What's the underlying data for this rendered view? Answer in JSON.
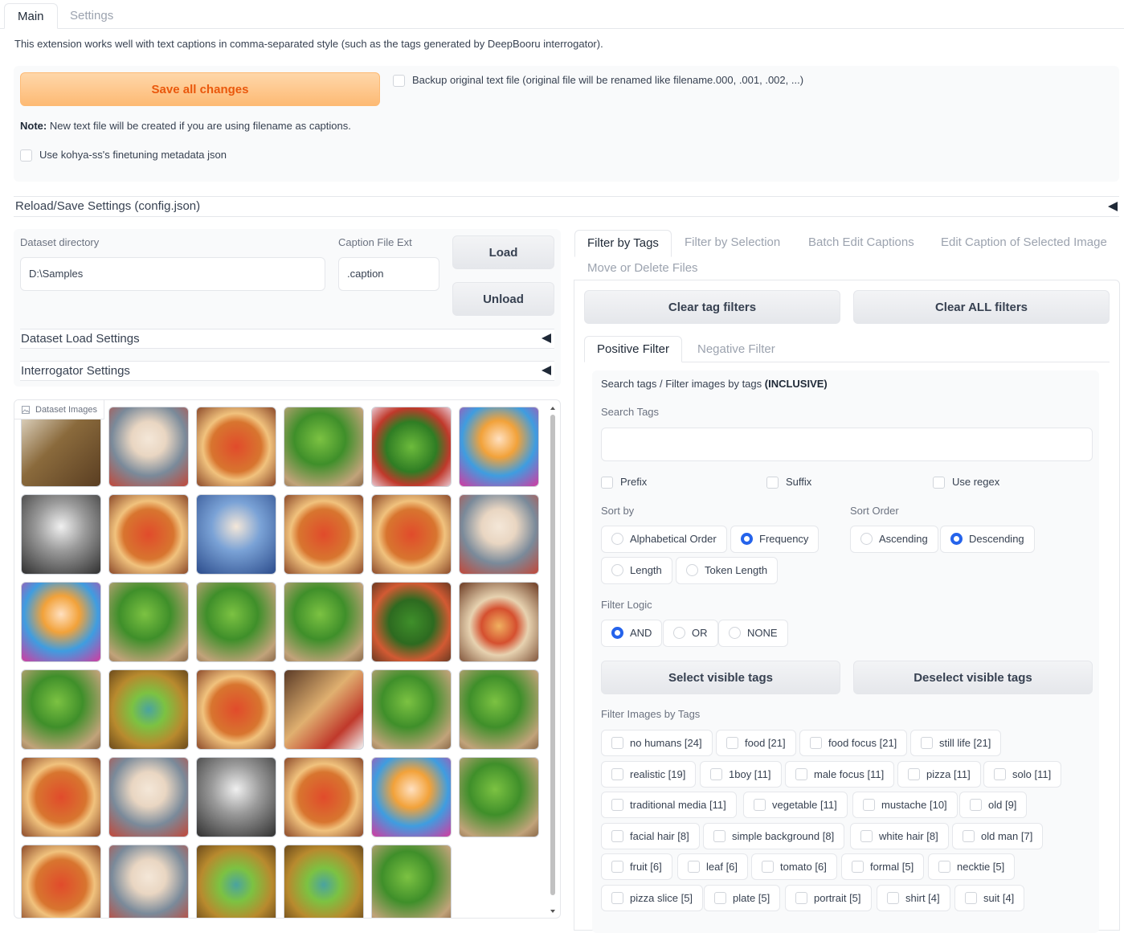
{
  "tabs": [
    {
      "label": "Main",
      "active": true
    },
    {
      "label": "Settings",
      "active": false
    }
  ],
  "description": "This extension works well with text captions in comma-separated style (such as the tags generated by DeepBooru interrogator).",
  "save": {
    "button_label": "Save all changes",
    "backup_label": "Backup original text file (original file will be renamed like filename.000, .001, .002, ...)",
    "note_bold": "Note:",
    "note_text": " New text file will be created if you are using filename as captions.",
    "kohya_label": "Use kohya-ss's finetuning metadata json"
  },
  "reload_settings_label": "Reload/Save Settings (config.json)",
  "dataset": {
    "dir_label": "Dataset directory",
    "dir_value": "D:\\Samples",
    "ext_label": "Caption File Ext",
    "ext_value": ".caption",
    "load_label": "Load",
    "unload_label": "Unload",
    "load_settings_label": "Dataset Load Settings",
    "interrogator_label": "Interrogator Settings"
  },
  "gallery": {
    "label": "Dataset Images",
    "images": [
      "man-writing",
      "einstein",
      "pizza",
      "broccoli",
      "broccoli-salad",
      "einstein-colorful",
      "einstein-bw",
      "pizza",
      "einstein-blue",
      "pizza",
      "pizza",
      "einstein",
      "einstein-colorful",
      "broccoli",
      "broccoli",
      "broccoli",
      "broccoli-pizza",
      "pizza-painting",
      "broccoli",
      "broccoli-frame",
      "pizza",
      "pizza-slices",
      "broccoli",
      "broccoli",
      "pizza",
      "einstein",
      "einstein-bw",
      "pizza",
      "einstein-colorful",
      "broccoli",
      "pizza",
      "einstein",
      "broccoli-frame",
      "broccoli-frame",
      "broccoli"
    ]
  },
  "right_tabs": [
    {
      "label": "Filter by Tags",
      "active": true
    },
    {
      "label": "Filter by Selection",
      "active": false
    },
    {
      "label": "Batch Edit Captions",
      "active": false
    },
    {
      "label": "Edit Caption of Selected Image",
      "active": false
    },
    {
      "label": "Move or Delete Files",
      "active": false
    }
  ],
  "filter": {
    "clear_tag_filters": "Clear tag filters",
    "clear_all_filters": "Clear ALL filters",
    "positive_tab": "Positive Filter",
    "negative_tab": "Negative Filter",
    "search_desc": "Search tags / Filter images by tags ",
    "search_desc_bold": "(INCLUSIVE)",
    "search_tags_label": "Search Tags",
    "search_value": "",
    "prefix_label": "Prefix",
    "suffix_label": "Suffix",
    "regex_label": "Use regex",
    "sort_by_label": "Sort by",
    "sort_by_options": [
      "Alphabetical Order",
      "Frequency",
      "Length",
      "Token Length"
    ],
    "sort_by_selected": "Frequency",
    "sort_order_label": "Sort Order",
    "sort_order_options": [
      "Ascending",
      "Descending"
    ],
    "sort_order_selected": "Descending",
    "filter_logic_label": "Filter Logic",
    "filter_logic_options": [
      "AND",
      "OR",
      "NONE"
    ],
    "filter_logic_selected": "AND",
    "select_visible": "Select visible tags",
    "deselect_visible": "Deselect visible tags",
    "filter_images_label": "Filter Images by Tags",
    "tags": [
      "no humans [24]",
      "food [21]",
      "food focus [21]",
      "still life [21]",
      "realistic [19]",
      "1boy [11]",
      "male focus [11]",
      "pizza [11]",
      "solo [11]",
      "traditional media [11]",
      "vegetable [11]",
      "mustache [10]",
      "old [9]",
      "facial hair [8]",
      "simple background [8]",
      "white hair [8]",
      "old man [7]",
      "fruit [6]",
      "leaf [6]",
      "tomato [6]",
      "formal [5]",
      "necktie [5]",
      "pizza slice [5]",
      "plate [5]",
      "portrait [5]",
      "shirt [4]",
      "suit [4]"
    ]
  },
  "colors": {
    "accent_blue": "#2563eb",
    "save_orange": "#ea580c",
    "border": "#e5e7eb"
  }
}
